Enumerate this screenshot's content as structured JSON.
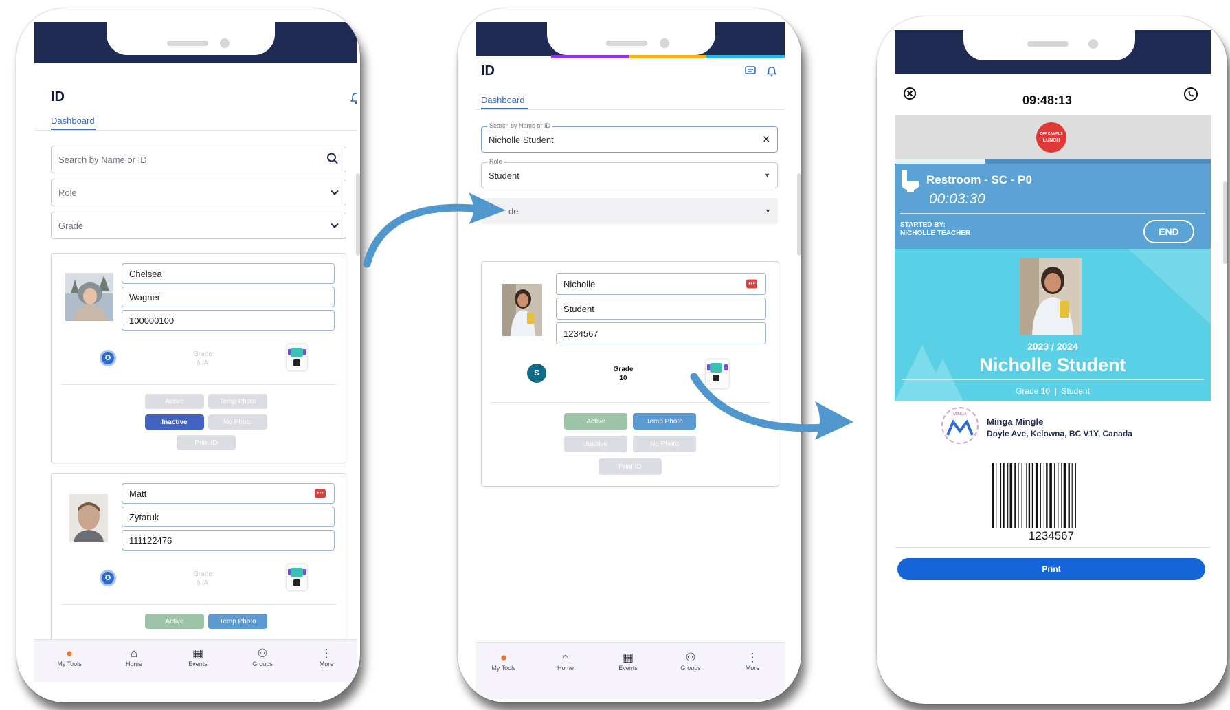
{
  "colors": {
    "navy": "#1f2b52",
    "accent": "#2f6bd0",
    "print": "#1565d8",
    "pass": "#5aa3d4",
    "id_bg": "#5ad0e6"
  },
  "phone1": {
    "title": "ID",
    "tab": "Dashboard",
    "search_placeholder": "Search by Name or ID",
    "role_placeholder": "Role",
    "grade_placeholder": "Grade",
    "cards": [
      {
        "first": "Chelsea",
        "last": "Wagner",
        "id": "100000100",
        "avatar": "O",
        "grade_label": "Grade",
        "grade_value": "N/A",
        "buttons": [
          "Active",
          "Temp Photo",
          "Inactive",
          "No Photo",
          "Print ID"
        ]
      },
      {
        "first": "Matt",
        "last": "Zytaruk",
        "id": "111122476",
        "avatar": "O",
        "grade_label": "Grade",
        "grade_value": "N/A",
        "buttons": [
          "Active",
          "Temp Photo"
        ]
      }
    ],
    "nav": [
      "My Tools",
      "Home",
      "Events",
      "Groups",
      "More"
    ]
  },
  "phone2": {
    "title": "ID",
    "tab": "Dashboard",
    "search_legend": "Search by Name or ID",
    "search_value": "Nicholle Student",
    "role_legend": "Role",
    "role_value": "Student",
    "grade_partial": "de",
    "card": {
      "first": "Nicholle",
      "role": "Student",
      "id": "1234567",
      "avatar": "S",
      "grade_label": "Grade",
      "grade_value": "10",
      "buttons": [
        "Active",
        "Temp Photo",
        "Inactive",
        "No Photo",
        "Print ID"
      ]
    },
    "nav": [
      "My Tools",
      "Home",
      "Events",
      "Groups",
      "More"
    ]
  },
  "phone3": {
    "time": "09:48:13",
    "sticker_line1": "OFF CAMPUS",
    "sticker_line2": "LUNCH",
    "pass_name": "Restroom - SC - P0",
    "pass_timer": "00:03:30",
    "started_by_label": "STARTED BY:",
    "started_by_name": "NICHOLLE TEACHER",
    "end_label": "END",
    "year": "2023 / 2024",
    "student_name": "Nicholle Student",
    "grade_line": "Grade 10  |  Student",
    "school_name": "Minga Mingle",
    "school_address": "Doyle Ave, Kelowna, BC V1Y, Canada",
    "logo_text": "MINGA",
    "barcode_number": "1234567",
    "print_label": "Print"
  }
}
